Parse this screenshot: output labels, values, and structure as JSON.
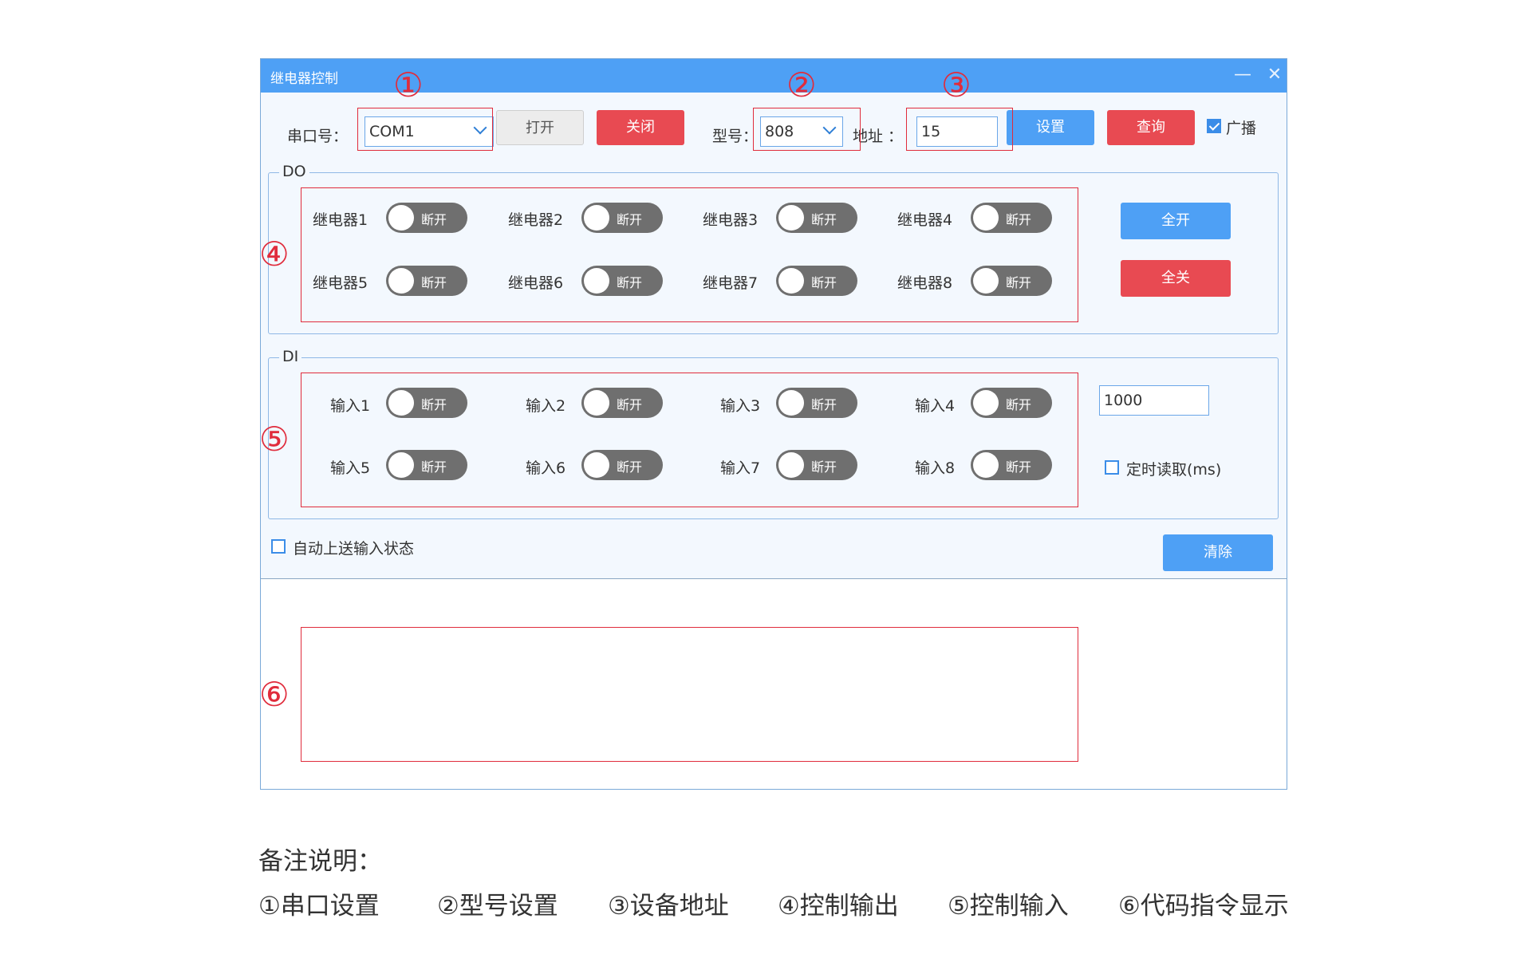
{
  "window": {
    "title": "继电器控制",
    "minimize_glyph": "—",
    "close_glyph": "✕"
  },
  "toolbar": {
    "port_label": "串口号：",
    "port_value": "COM1",
    "open_label": "打开",
    "close_label": "关闭",
    "model_label": "型号：",
    "model_value": "808",
    "address_label": "地址 ：",
    "address_value": "15",
    "set_label": "设置",
    "query_label": "查询",
    "broadcast_label": "广播",
    "broadcast_checked": true
  },
  "do_group": {
    "title": "DO",
    "relays": [
      {
        "label": "继电器1",
        "state": "断开"
      },
      {
        "label": "继电器2",
        "state": "断开"
      },
      {
        "label": "继电器3",
        "state": "断开"
      },
      {
        "label": "继电器4",
        "state": "断开"
      },
      {
        "label": "继电器5",
        "state": "断开"
      },
      {
        "label": "继电器6",
        "state": "断开"
      },
      {
        "label": "继电器7",
        "state": "断开"
      },
      {
        "label": "继电器8",
        "state": "断开"
      }
    ],
    "all_on_label": "全开",
    "all_off_label": "全关"
  },
  "di_group": {
    "title": "DI",
    "inputs": [
      {
        "label": "输入1",
        "state": "断开"
      },
      {
        "label": "输入2",
        "state": "断开"
      },
      {
        "label": "输入3",
        "state": "断开"
      },
      {
        "label": "输入4",
        "state": "断开"
      },
      {
        "label": "输入5",
        "state": "断开"
      },
      {
        "label": "输入6",
        "state": "断开"
      },
      {
        "label": "输入7",
        "state": "断开"
      },
      {
        "label": "输入8",
        "state": "断开"
      }
    ],
    "interval_value": "1000",
    "timed_read_label": "定时读取(ms)",
    "timed_read_checked": false
  },
  "bottom": {
    "auto_upload_label": "自动上送输入状态",
    "auto_upload_checked": false,
    "clear_label": "清除"
  },
  "markers": {
    "m1": "①",
    "m2": "②",
    "m3": "③",
    "m4": "④",
    "m5": "⑤",
    "m6": "⑥"
  },
  "notes": {
    "heading": "备注说明：",
    "items": [
      "①串口设置",
      "②型号设置",
      "③设备地址",
      "④控制输出",
      "⑤控制输入",
      "⑥代码指令显示"
    ]
  },
  "colors": {
    "titlebar": "#4ea0f5",
    "button_blue": "#4ea0f5",
    "button_red": "#e84a52",
    "annotation_red": "#e02c3c",
    "toggle_off": "#6f6f6f"
  }
}
